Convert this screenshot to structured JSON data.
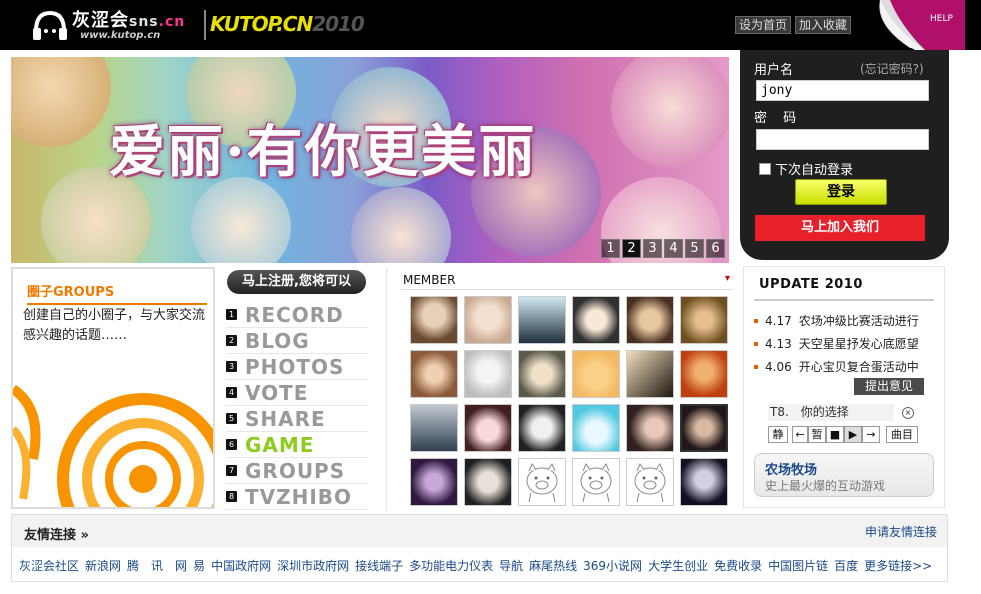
{
  "header": {
    "logo_main": "灰涩会",
    "logo_sns": "sns",
    "logo_cn": ".cn",
    "logo_url": "www.kutop.cn",
    "brand_text": "KUTOP.CN",
    "brand_year": "2010",
    "btn_home": "设为首页",
    "btn_favorite": "加入收藏",
    "help": "HELP"
  },
  "banner": {
    "title": "爱丽·有你更美丽",
    "pages": [
      "1",
      "2",
      "3",
      "4",
      "5",
      "6"
    ],
    "active_page": "2"
  },
  "login": {
    "username_label": "用户名",
    "forgot_label": "(忘记密码?)",
    "username_value": "jony",
    "password_label": "密 码",
    "auto_login_label": "下次自动登录",
    "login_button": "登录",
    "join_button": "马上加入我们"
  },
  "groups": {
    "title": "圈子GROUPS",
    "description": "创建自己的小圈子，与大家交流感兴趣的话题……"
  },
  "menu": {
    "header": "马上注册,您将可以",
    "items": [
      {
        "num": "1",
        "label": "RECORD"
      },
      {
        "num": "2",
        "label": "BLOG"
      },
      {
        "num": "3",
        "label": "PHOTOS"
      },
      {
        "num": "4",
        "label": "VOTE"
      },
      {
        "num": "5",
        "label": "SHARE"
      },
      {
        "num": "6",
        "label": "GAME"
      },
      {
        "num": "7",
        "label": "GROUPS"
      },
      {
        "num": "8",
        "label": "TVZHIBO"
      }
    ]
  },
  "member": {
    "title": "MEMBER",
    "arrow": "▾"
  },
  "update": {
    "title": "UPDATE 2010",
    "news": [
      {
        "date": "4.17",
        "text": "农场冲级比赛活动进行"
      },
      {
        "date": "4.13",
        "text": "天空星星抒发心底愿望"
      },
      {
        "date": "4.06",
        "text": "开心宝贝复合蛋活动中"
      }
    ],
    "more_button": "提出意见",
    "player_index": "T8.",
    "player_track": "你的选择",
    "ctrl_mute": "静",
    "ctrl_prev": "←",
    "ctrl_pause": "暂",
    "ctrl_stop": "■",
    "ctrl_play": "▶",
    "ctrl_next": "→",
    "ctrl_list": "曲目",
    "farm_title": "农场牧场",
    "farm_desc": "史上最火爆的互动游戏"
  },
  "friends": {
    "title": "友情连接",
    "title_arrow": "»",
    "apply": "申请友情连接",
    "links": [
      "灰涩会社区",
      "新浪网",
      "腾　讯　网",
      "易",
      "中国政府网",
      "深圳市政府网",
      "接线端子",
      "多功能电力仪表",
      "导航",
      "麻尾热线",
      "369小说网",
      "大学生创业",
      "免费收录",
      "中国图片链",
      "百度",
      "更多链接>>"
    ]
  }
}
